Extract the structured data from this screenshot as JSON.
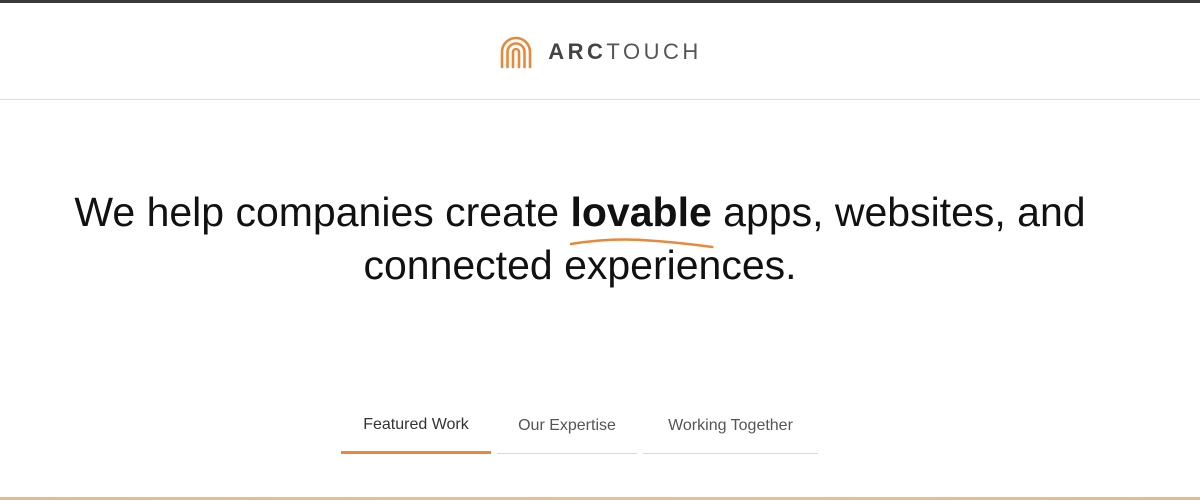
{
  "header": {
    "logo": {
      "icon": "arctouch-arc-icon",
      "text_strong": "ARC",
      "text_light": "TOUCH",
      "accent_color": "#E8883A"
    }
  },
  "hero": {
    "text_before": "We help companies create ",
    "text_emphasis": "lovable",
    "text_after_line1": " apps, websites, and",
    "text_line2": "connected experiences."
  },
  "tabs": [
    {
      "label": "Featured Work",
      "active": true
    },
    {
      "label": "Our Expertise",
      "active": false
    },
    {
      "label": "Working Together",
      "active": false
    }
  ],
  "colors": {
    "accent": "#E8883A",
    "text": "#111111",
    "muted": "#555555"
  }
}
